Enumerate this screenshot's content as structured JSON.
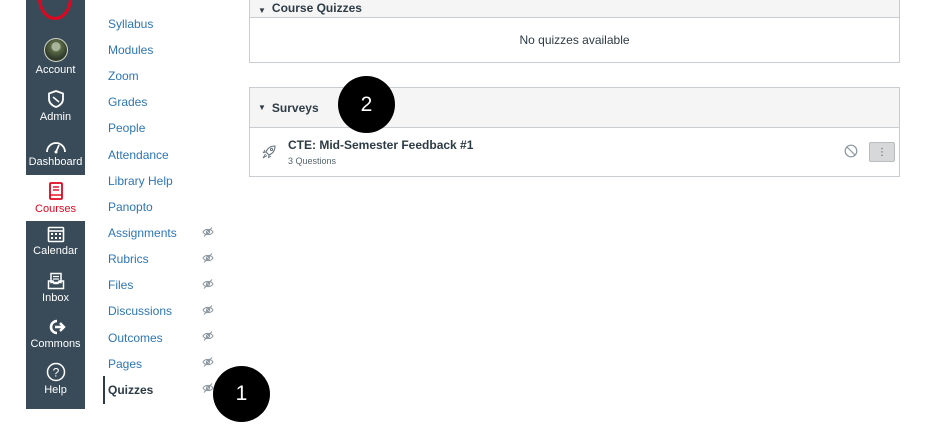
{
  "global_nav": {
    "items": [
      {
        "label": "Account",
        "icon": "avatar"
      },
      {
        "label": "Admin",
        "icon": "shield-icon"
      },
      {
        "label": "Dashboard",
        "icon": "dashboard-icon"
      },
      {
        "label": "Courses",
        "icon": "book-icon",
        "active": true
      },
      {
        "label": "Calendar",
        "icon": "calendar-icon"
      },
      {
        "label": "Inbox",
        "icon": "inbox-icon"
      },
      {
        "label": "Commons",
        "icon": "commons-icon"
      },
      {
        "label": "Help",
        "icon": "help-icon"
      }
    ],
    "colors": {
      "background": "#394b58",
      "active": "#e0061f"
    }
  },
  "course_nav": {
    "items": [
      {
        "label": "Syllabus"
      },
      {
        "label": "Modules"
      },
      {
        "label": "Zoom"
      },
      {
        "label": "Grades"
      },
      {
        "label": "People"
      },
      {
        "label": "Attendance"
      },
      {
        "label": "Library Help"
      },
      {
        "label": "Panopto"
      },
      {
        "label": "Assignments",
        "hidden": true
      },
      {
        "label": "Rubrics",
        "hidden": true
      },
      {
        "label": "Files",
        "hidden": true
      },
      {
        "label": "Discussions",
        "hidden": true
      },
      {
        "label": "Outcomes",
        "hidden": true
      },
      {
        "label": "Pages",
        "hidden": true
      },
      {
        "label": "Quizzes",
        "hidden": true,
        "active": true
      }
    ],
    "link_color": "#2d76b3"
  },
  "main": {
    "course_quizzes": {
      "title": "Course Quizzes",
      "empty_message": "No quizzes available"
    },
    "surveys": {
      "title": "Surveys",
      "items": [
        {
          "title": "CTE: Mid-Semester Feedback #1",
          "subtitle": "3 Questions",
          "status": "unpublished"
        }
      ]
    }
  },
  "callouts": {
    "step1": "1",
    "step2": "2"
  }
}
